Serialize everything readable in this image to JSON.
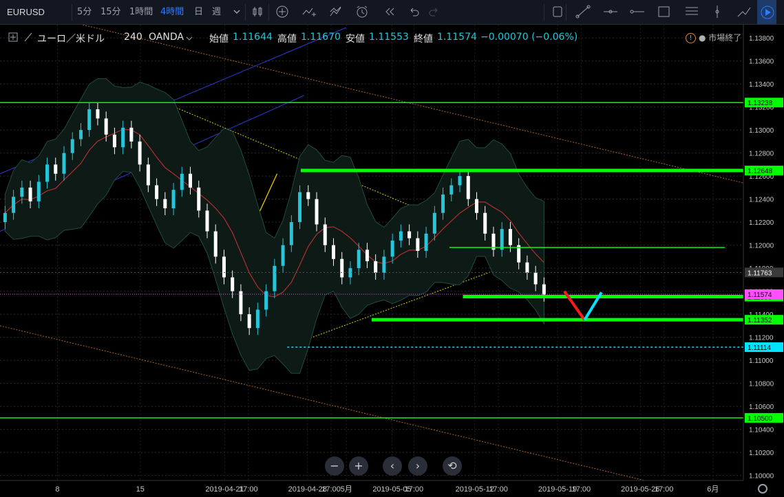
{
  "toolbar": {
    "symbol": "EURUSD",
    "intervals": [
      "5分",
      "15分",
      "1時間",
      "4時間",
      "日",
      "週"
    ],
    "active_interval": "4時間"
  },
  "legend": {
    "instrument": "ユーロ／米ドル",
    "timeframe": "240",
    "broker": "OANDA",
    "open_label": "始値",
    "open": "1.11644",
    "high_label": "高値",
    "high": "1.11670",
    "low_label": "安値",
    "low": "1.11553",
    "close_label": "終値",
    "close": "1.11574",
    "change": "−0.00070 (−0.06%)"
  },
  "market_status": "市場終了",
  "colors": {
    "background": "#000000",
    "up": "#26c6da",
    "down": "#ffffff",
    "horizontal_level": "#00ff00",
    "current_price": "#ff4fff",
    "dotted_level": "#00e5ff",
    "ma": "#b03030",
    "bollinger": "#1f4d3f",
    "channel_upper": "#2b3bd6",
    "trend_long": "#b5651d",
    "trend_short": "#d6d600",
    "arrow_down": "#ff1a1a",
    "arrow_up": "#00e5ff"
  },
  "chart_data": {
    "type": "candlestick",
    "price_range": [
      1.0998,
      1.1389
    ],
    "y_ticks": [
      "1.13800",
      "1.13600",
      "1.13400",
      "1.13200",
      "1.13000",
      "1.12800",
      "1.12600",
      "1.12400",
      "1.12200",
      "1.12000",
      "1.11800",
      "1.11600",
      "1.11400",
      "1.11200",
      "1.11000",
      "1.10800",
      "1.10600",
      "1.10400",
      "1.10200",
      "1.10000"
    ],
    "x_labels": [
      "8",
      "15",
      "2019-04-21",
      "17:00",
      "2019-04-28",
      "17:00",
      "5月",
      "2019-05-05",
      "17:00",
      "2019-05-12",
      "17:00",
      "2019-05-19",
      "17:00",
      "2019-05-26",
      "17:00",
      "6月"
    ],
    "x_label_values": [
      3.4,
      8.3,
      13.3,
      14.7,
      18.2,
      19.6,
      20.5,
      23.2,
      24.5,
      28.1,
      29.5,
      33.0,
      34.4,
      37.9,
      39.3,
      42.2
    ],
    "x_range": [
      0,
      44
    ],
    "horizontal_levels": [
      {
        "price": 1.13238,
        "label": "1.13238",
        "from_day": 0,
        "thick": false
      },
      {
        "price": 1.12648,
        "label": "1.12648",
        "from_day": 17.8,
        "thick": true
      },
      {
        "price": 1.11553,
        "label": "1.11553",
        "from_day": 27.4,
        "thick": true
      },
      {
        "price": 1.11352,
        "label": "1.11352",
        "from_day": 22.0,
        "thick": true
      },
      {
        "price": 1.105,
        "label": "1.10500",
        "from_day": 0,
        "thick": false
      },
      {
        "price": 1.1198,
        "from_day": 26.6,
        "to_day": 42.9,
        "thick": false,
        "label": ""
      }
    ],
    "price_labels": [
      {
        "price": 1.11763,
        "label": "1.11763",
        "style": "gray"
      },
      {
        "price": 1.11574,
        "label": "1.11574",
        "style": "current"
      },
      {
        "price": 1.11114,
        "label": "1.11114",
        "style": "dotted"
      }
    ],
    "series": {
      "candles_up_close": [
        1.1228,
        1.1242,
        1.125,
        1.1238,
        1.1255,
        1.127,
        1.1262,
        1.128,
        1.1292,
        1.13,
        1.1318,
        1.131,
        1.1296,
        1.1285,
        1.1302,
        1.129,
        1.127,
        1.1252,
        1.124,
        1.1232,
        1.1248,
        1.1262,
        1.125,
        1.123,
        1.1212,
        1.119,
        1.1172,
        1.116,
        1.114,
        1.1128,
        1.1144,
        1.116,
        1.1182,
        1.12,
        1.122,
        1.1246,
        1.124,
        1.1218,
        1.12,
        1.1188,
        1.1172,
        1.118,
        1.1196,
        1.1186,
        1.1176,
        1.119,
        1.1204,
        1.1212,
        1.1206,
        1.1195,
        1.121,
        1.1228,
        1.1244,
        1.1252,
        1.126,
        1.124,
        1.1228,
        1.121,
        1.1196,
        1.1214,
        1.12,
        1.1185,
        1.1176,
        1.1166,
        1.1157
      ]
    }
  }
}
